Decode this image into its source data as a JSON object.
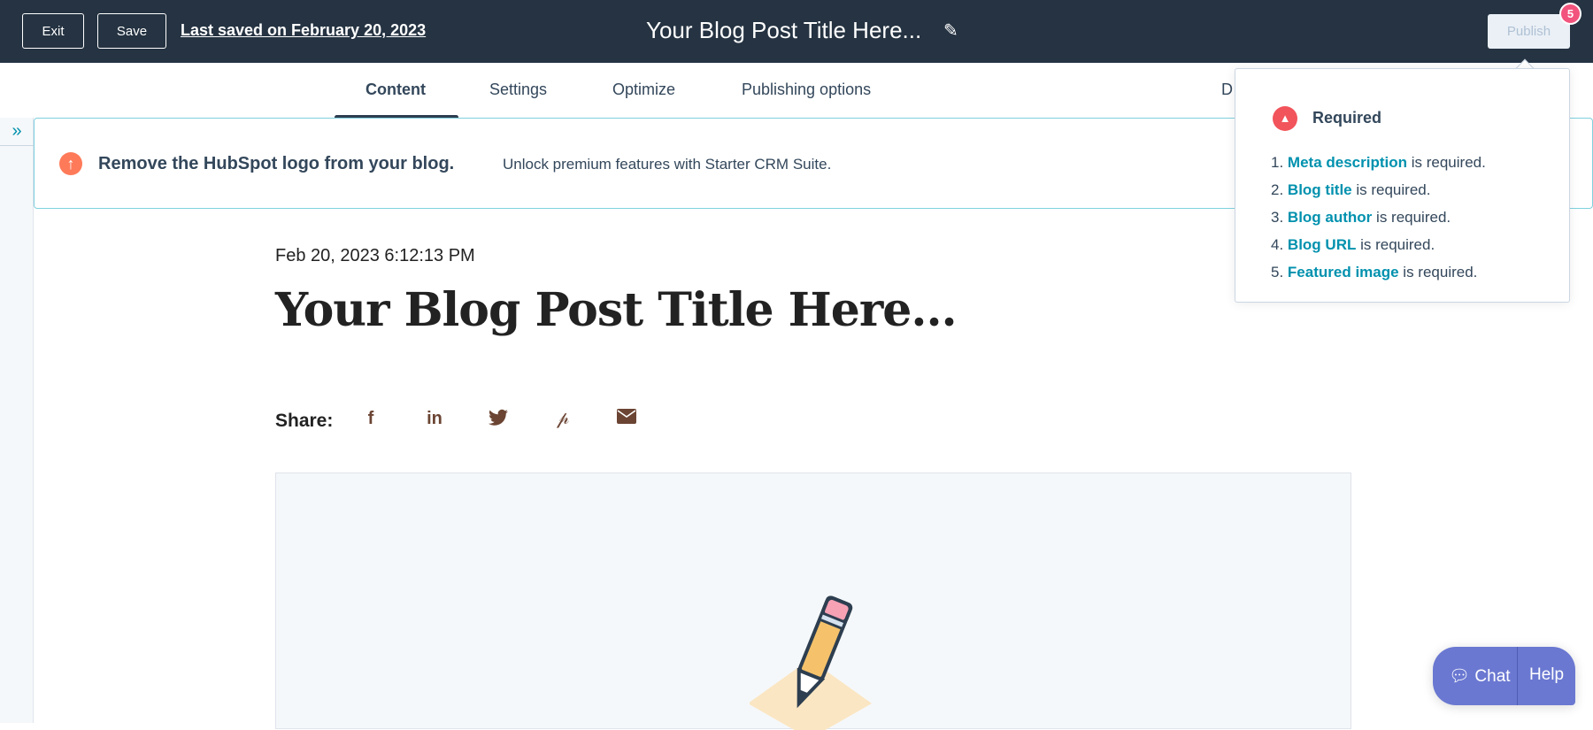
{
  "header": {
    "exit_label": "Exit",
    "save_label": "Save",
    "last_saved": "Last saved on February 20, 2023",
    "title": "Your Blog Post Title Here...",
    "publish_label": "Publish",
    "publish_badge": "5"
  },
  "tabs": [
    {
      "label": "Content",
      "active": true
    },
    {
      "label": "Settings"
    },
    {
      "label": "Optimize"
    },
    {
      "label": "Publishing options"
    },
    {
      "label": "D"
    }
  ],
  "banner": {
    "title": "Remove the HubSpot logo from your blog.",
    "subtitle": "Unlock premium features with Starter CRM Suite."
  },
  "post": {
    "date": "Feb 20, 2023 6:12:13 PM",
    "title": "Your Blog Post Title Here...",
    "share_label": "Share:",
    "share_icons": [
      "facebook-icon",
      "linkedin-icon",
      "twitter-icon",
      "pinterest-icon",
      "email-icon"
    ]
  },
  "popover": {
    "title": "Required",
    "items": [
      {
        "num": "1.",
        "link": "Meta description",
        "rest": " is required."
      },
      {
        "num": "2.",
        "link": "Blog title",
        "rest": " is required."
      },
      {
        "num": "3.",
        "link": "Blog author",
        "rest": " is required."
      },
      {
        "num": "4.",
        "link": "Blog URL",
        "rest": " is required."
      },
      {
        "num": "5.",
        "link": "Featured image",
        "rest": " is required."
      }
    ]
  },
  "chat": {
    "chat_label": "Chat",
    "help_label": "Help"
  },
  "colors": {
    "header": "#253342",
    "accent": "#0091ae",
    "badge": "#f2547d",
    "chat": "#6a78d1",
    "share_icons": "#6b4433"
  }
}
